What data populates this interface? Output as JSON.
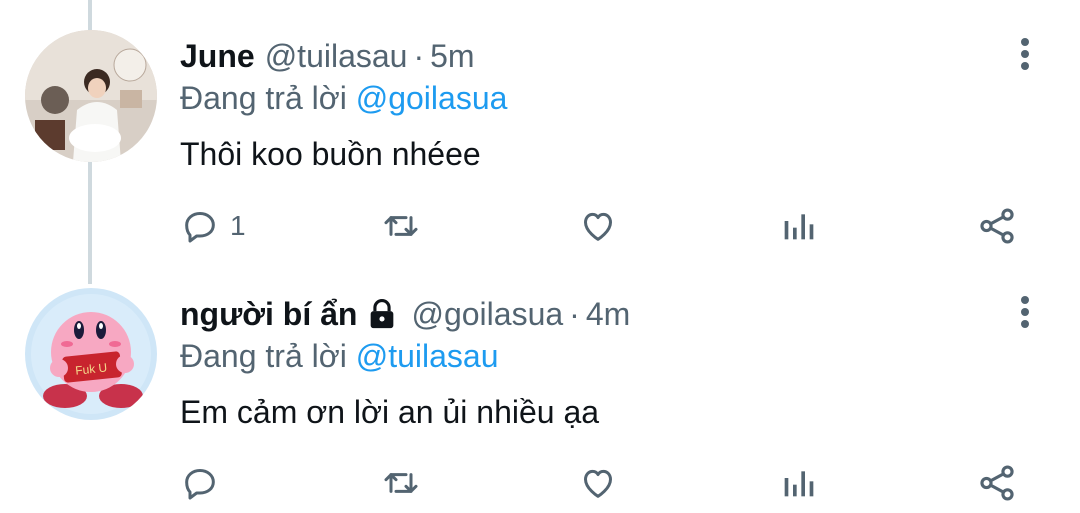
{
  "tweets": [
    {
      "name": "June",
      "handle": "@tuilasau",
      "separator": "·",
      "time": "5m",
      "replying_label": "Đang trả lời",
      "replying_to": "@goilasua",
      "text": "Thôi koo buồn nhéee",
      "reply_count": "1",
      "locked": false
    },
    {
      "name": "người bí ẩn",
      "handle": "@goilasua",
      "separator": "·",
      "time": "4m",
      "replying_label": "Đang trả lời",
      "replying_to": "@tuilasau",
      "text": "Em cảm ơn lời an ủi nhiều ạa",
      "reply_count": "",
      "locked": true
    }
  ],
  "icons": {
    "reply": "reply-icon",
    "retweet": "retweet-icon",
    "like": "heart-icon",
    "analytics": "analytics-icon",
    "share": "share-icon",
    "more": "more-vertical-icon",
    "lock": "lock-icon"
  },
  "colors": {
    "text": "#0f1419",
    "secondary": "#536471",
    "link": "#1d9bf0",
    "thread_line": "#cfd9de"
  }
}
